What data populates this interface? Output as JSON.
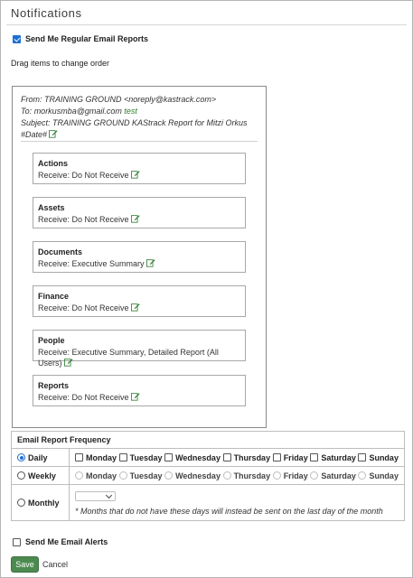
{
  "page": {
    "title": "Notifications"
  },
  "regular_reports": {
    "label": "Send Me Regular Email Reports",
    "checked": true
  },
  "hint": "Drag items to change order",
  "email": {
    "from": "From: TRAINING GROUND <noreply@kastrack.com>",
    "to_prefix": "To: ",
    "to_address": "morkusmba@gmail.com",
    "to_link": "test",
    "subject": "Subject: TRAINING GROUND KAStrack Report for Mitzi Orkus #Date#"
  },
  "sections": [
    {
      "title": "Actions",
      "receive": "Receive: Do Not Receive"
    },
    {
      "title": "Assets",
      "receive": "Receive: Do Not Receive"
    },
    {
      "title": "Documents",
      "receive": "Receive: Executive Summary"
    },
    {
      "title": "Finance",
      "receive": "Receive: Do Not Receive"
    },
    {
      "title": "People",
      "receive": "Receive: Executive Summary, Detailed Report (All Users)"
    },
    {
      "title": "Reports",
      "receive": "Receive: Do Not Receive"
    }
  ],
  "frequency": {
    "heading": "Email Report Frequency",
    "selected": "Daily",
    "daily_label": "Daily",
    "weekly_label": "Weekly",
    "monthly_label": "Monthly",
    "days": [
      "Monday",
      "Tuesday",
      "Wednesday",
      "Thursday",
      "Friday",
      "Saturday",
      "Sunday"
    ],
    "monthly_day_value": "",
    "monthly_note": "* Months that do not have these days will instead be sent on the last day of the month"
  },
  "alerts": {
    "label": "Send Me Email Alerts",
    "checked": false
  },
  "actions": {
    "save": "Save",
    "cancel": "Cancel"
  },
  "colors": {
    "accent": "#1f6fd1",
    "save_button": "#4c8a4f",
    "link_green": "#2e7d32"
  }
}
